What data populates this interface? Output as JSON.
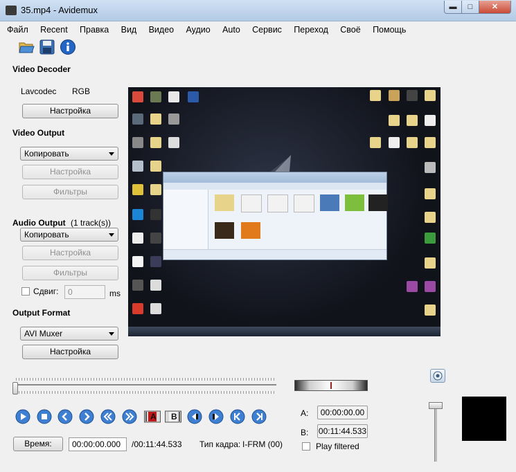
{
  "window": {
    "title": "35.mp4 - Avidemux",
    "min_glyph": "▬",
    "max_glyph": "□",
    "close_glyph": "✕"
  },
  "menu": [
    "Файл",
    "Recent",
    "Правка",
    "Вид",
    "Видео",
    "Аудио",
    "Auto",
    "Сервис",
    "Переход",
    "Своё",
    "Помощь"
  ],
  "toolbar": {
    "icons": [
      "open-folder-icon",
      "save-disk-icon",
      "info-icon"
    ]
  },
  "video_decoder": {
    "title": "Video Decoder",
    "codec": "Lavcodec",
    "colorspace": "RGB",
    "configure": "Настройка"
  },
  "video_output": {
    "title": "Video Output",
    "selected": "Копировать",
    "configure": "Настройка",
    "filters": "Фильтры"
  },
  "audio_output": {
    "title": "Audio Output",
    "tracks": "(1 track(s))",
    "selected": "Копировать",
    "configure": "Настройка",
    "filters": "Фильтры",
    "shift_label": "Сдвиг:",
    "shift_value": "0",
    "shift_unit": "ms"
  },
  "output_format": {
    "title": "Output Format",
    "selected": "AVI Muxer",
    "configure": "Настройка"
  },
  "playback": {
    "buttons": [
      "play-icon",
      "stop-icon",
      "prev-frame-icon",
      "next-frame-icon",
      "prev-keyframe-icon",
      "next-keyframe-icon",
      "set-marker-a-icon",
      "set-marker-b-icon",
      "prev-black-frame-icon",
      "next-black-frame-icon",
      "goto-start-icon",
      "goto-end-icon"
    ],
    "marker_a_text": "A",
    "marker_b_text": "B"
  },
  "markers": {
    "a_label": "A:",
    "a_value": "00:00:00.00",
    "b_label": "B:",
    "b_value": "00:11:44.533",
    "play_filtered": "Play filtered"
  },
  "time": {
    "button": "Время:",
    "current": "00:00:00.000",
    "total": "/00:11:44.533",
    "frame_type_label": "Тип кадра:",
    "frame_type_value": "I-FRM (00)"
  },
  "colors": {
    "accent": "#2e6fc2",
    "marker_red": "#c01818"
  }
}
